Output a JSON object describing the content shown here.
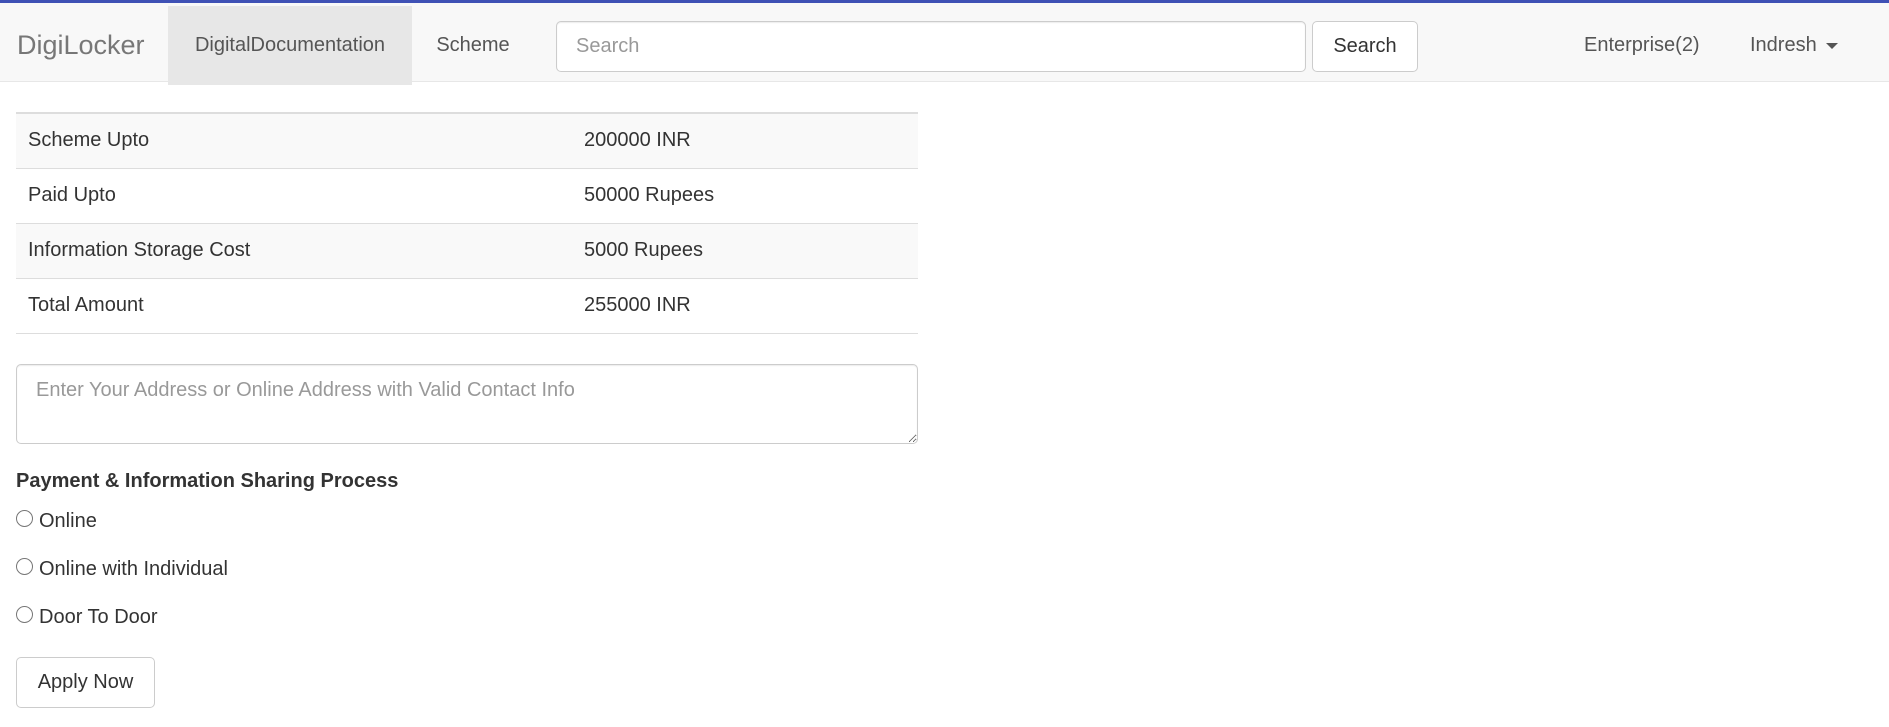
{
  "navbar": {
    "brand": "DigiLocker",
    "links": [
      {
        "label": "DigitalDocumentation",
        "active": true
      },
      {
        "label": "Scheme",
        "active": false
      }
    ],
    "search": {
      "placeholder": "Search",
      "value": "",
      "button_label": "Search"
    },
    "enterprise_label": "Enterprise(2)",
    "user_label": "Indresh",
    "accent_color": "#3f51b5"
  },
  "details_table": {
    "rows": [
      {
        "label": "Scheme Upto",
        "value": "200000 INR"
      },
      {
        "label": "Paid Upto",
        "value": "50000 Rupees"
      },
      {
        "label": "Information Storage Cost",
        "value": "5000 Rupees"
      },
      {
        "label": "Total Amount",
        "value": "255000 INR"
      }
    ]
  },
  "address": {
    "placeholder": "Enter Your Address or Online Address with Valid Contact Info",
    "value": ""
  },
  "payment_process": {
    "heading": "Payment & Information Sharing Process",
    "options": [
      {
        "label": "Online",
        "selected": false
      },
      {
        "label": "Online with Individual",
        "selected": false
      },
      {
        "label": "Door To Door",
        "selected": false
      }
    ]
  },
  "apply_button_label": "Apply Now"
}
